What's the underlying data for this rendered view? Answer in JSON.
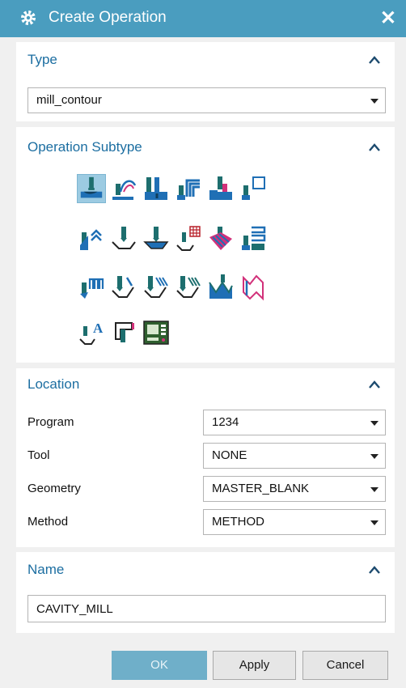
{
  "window": {
    "title": "Create Operation",
    "close_label": "✕"
  },
  "type_section": {
    "title": "Type",
    "selected": "mill_contour"
  },
  "subtype_section": {
    "title": "Operation Subtype",
    "icons": [
      "cavity-mill-icon",
      "adaptive-milling-icon",
      "plunge-milling-icon",
      "corner-rough-icon",
      "rest-milling-icon",
      "zlevel-profile-icon",
      "zlevel-corner-icon",
      "fixed-contour-icon",
      "contour-area-icon",
      "contour-surface-area-icon",
      "streamline-icon",
      "contour-area-non-steep-icon",
      "contour-area-dir-steep-icon",
      "flowcut-single-icon",
      "flowcut-multiple-icon",
      "flowcut-ref-tool-icon",
      "solid-profile-3d-icon",
      "contour-profile-icon",
      "contour-text-icon",
      "mill-user-icon",
      "mill-control-icon"
    ],
    "selected_icon": "cavity-mill-icon"
  },
  "location_section": {
    "title": "Location",
    "rows": [
      {
        "label": "Program",
        "value": "1234"
      },
      {
        "label": "Tool",
        "value": "NONE"
      },
      {
        "label": "Geometry",
        "value": "MASTER_BLANK"
      },
      {
        "label": "Method",
        "value": "METHOD"
      }
    ]
  },
  "name_section": {
    "title": "Name",
    "value": "CAVITY_MILL"
  },
  "buttons": {
    "ok": "OK",
    "apply": "Apply",
    "cancel": "Cancel"
  },
  "colors": {
    "titlebar": "#4a9dbf",
    "section_title": "#1c6ea1",
    "ok_button": "#6fafc9",
    "icon_blue": "#1f6fb5",
    "icon_teal": "#1d6e6e"
  }
}
